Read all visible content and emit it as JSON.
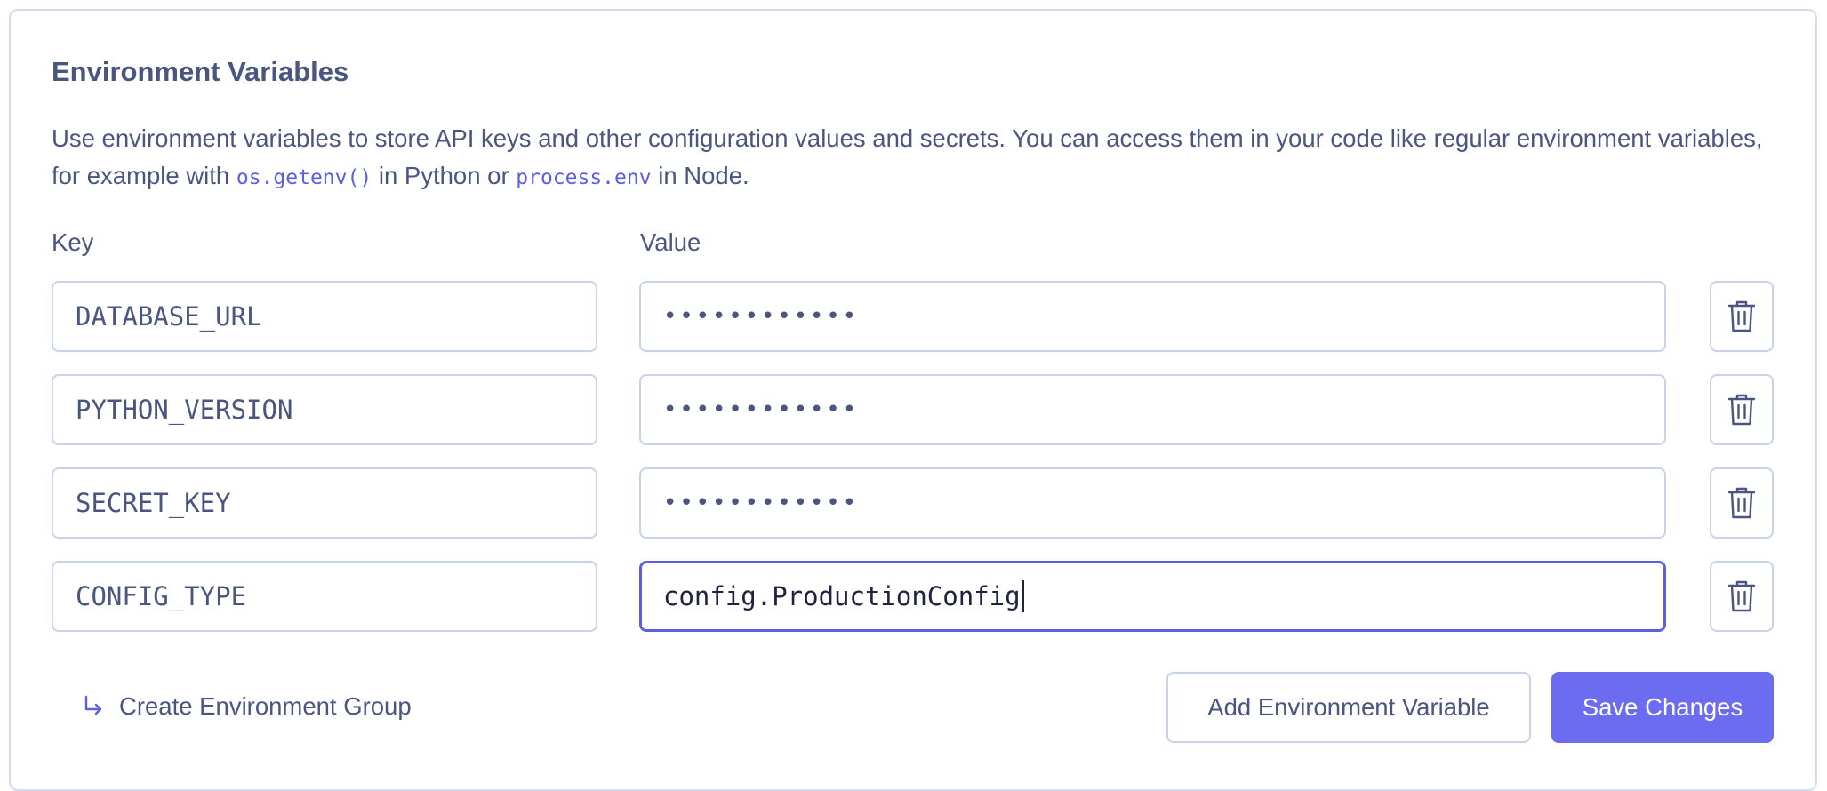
{
  "section": {
    "title": "Environment Variables",
    "description": {
      "part1": "Use environment variables to store API keys and other configuration values and secrets. You can access them in your code like regular environment variables, for example with ",
      "code1": "os.getenv()",
      "part2": " in Python or ",
      "code2": "process.env",
      "part3": " in Node."
    }
  },
  "columns": {
    "key_label": "Key",
    "value_label": "Value"
  },
  "variables": [
    {
      "key": "DATABASE_URL",
      "value": "••••••••••••",
      "masked": true
    },
    {
      "key": "PYTHON_VERSION",
      "value": "••••••••••••",
      "masked": true
    },
    {
      "key": "SECRET_KEY",
      "value": "••••••••••••",
      "masked": true
    },
    {
      "key": "CONFIG_TYPE",
      "value": "config.ProductionConfig",
      "masked": false,
      "focused": true
    }
  ],
  "actions": {
    "create_group_label": "Create Environment Group",
    "add_variable_label": "Add Environment Variable",
    "save_label": "Save Changes"
  },
  "icons": {
    "delete": "trash-icon",
    "create_group": "arrow-return-right-icon"
  },
  "colors": {
    "accent": "#5b5fe0",
    "primary_button": "#6b6cf0",
    "text": "#4a5580",
    "border": "#c8d2ea"
  }
}
